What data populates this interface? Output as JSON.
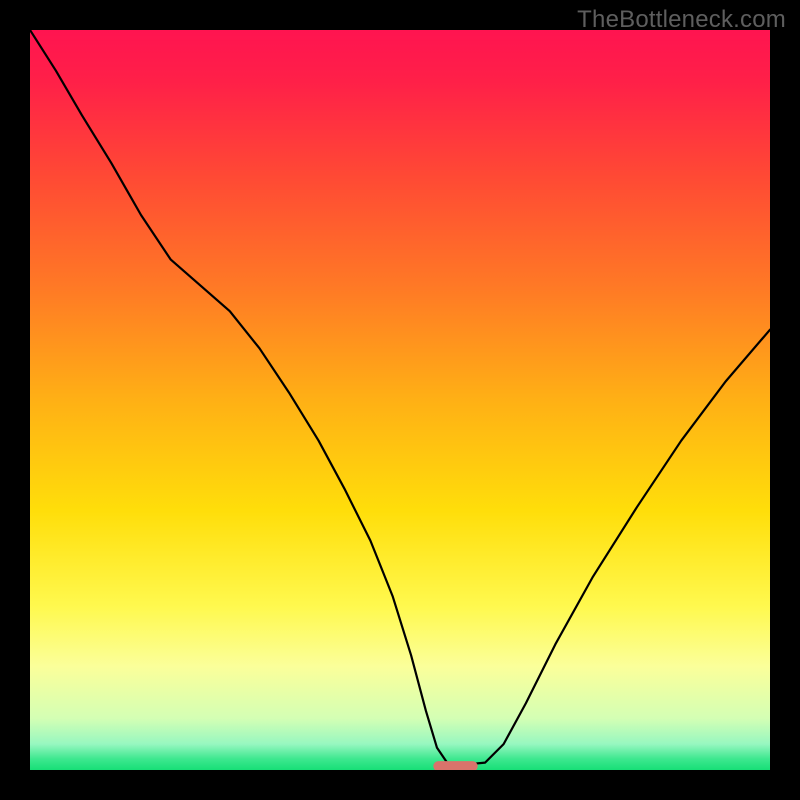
{
  "watermark": "TheBottleneck.com",
  "chart_data": {
    "type": "line",
    "title": "",
    "xlabel": "",
    "ylabel": "",
    "xlim": [
      0,
      100
    ],
    "ylim": [
      0,
      100
    ],
    "grid": false,
    "legend": false,
    "background_gradient": [
      {
        "stop": 0.0,
        "color": "#ff1450"
      },
      {
        "stop": 0.07,
        "color": "#ff2048"
      },
      {
        "stop": 0.2,
        "color": "#ff4a34"
      },
      {
        "stop": 0.35,
        "color": "#ff7a25"
      },
      {
        "stop": 0.5,
        "color": "#ffb015"
      },
      {
        "stop": 0.65,
        "color": "#ffde0a"
      },
      {
        "stop": 0.78,
        "color": "#fff94f"
      },
      {
        "stop": 0.86,
        "color": "#fbff9a"
      },
      {
        "stop": 0.93,
        "color": "#d4ffb4"
      },
      {
        "stop": 0.965,
        "color": "#97f7c0"
      },
      {
        "stop": 0.985,
        "color": "#3de88f"
      },
      {
        "stop": 1.0,
        "color": "#17df77"
      }
    ],
    "curve": {
      "x": [
        0.0,
        3.5,
        7.0,
        11.0,
        15.0,
        19.0,
        23.0,
        27.0,
        31.0,
        35.0,
        39.0,
        42.5,
        46.0,
        49.0,
        51.5,
        53.5,
        55.0,
        56.5,
        58.5,
        61.5,
        64.0,
        67.0,
        71.0,
        76.0,
        82.0,
        88.0,
        94.0,
        100.0
      ],
      "y": [
        100.0,
        94.5,
        88.5,
        82.0,
        75.0,
        69.0,
        65.5,
        62.0,
        57.0,
        51.0,
        44.5,
        38.0,
        31.0,
        23.5,
        15.5,
        8.0,
        3.0,
        0.8,
        0.7,
        1.0,
        3.5,
        9.0,
        17.0,
        26.0,
        35.5,
        44.5,
        52.5,
        59.5
      ]
    },
    "marker": {
      "x_center": 57.5,
      "y": 0.5,
      "width": 6.0,
      "height": 1.4,
      "color": "#d9736b"
    }
  }
}
